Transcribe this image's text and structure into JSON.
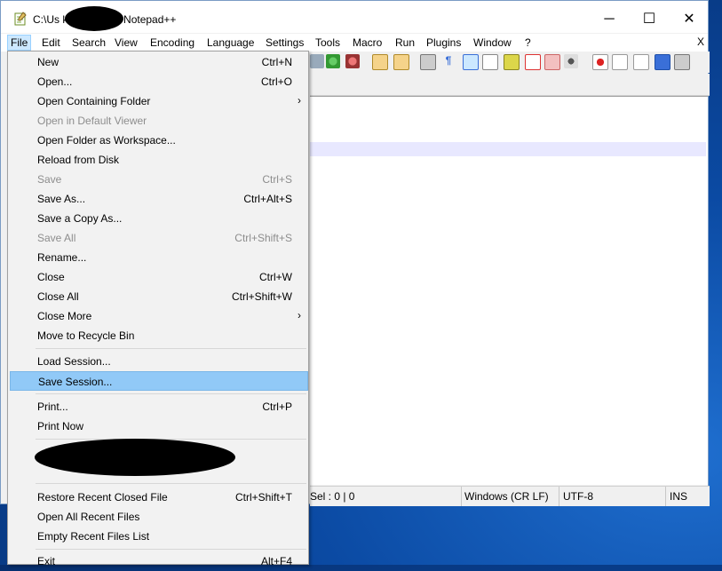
{
  "window": {
    "title": "C:\\Us          ktop\\new 1 - Notepad++",
    "controls": {
      "minimize": "─",
      "maximize": "☐",
      "close": "✕"
    }
  },
  "menubar": {
    "items": [
      "File",
      "Edit",
      "Search",
      "View",
      "Encoding",
      "Language",
      "Settings",
      "Tools",
      "Macro",
      "Run",
      "Plugins",
      "Window",
      "?"
    ],
    "close_doc": "X"
  },
  "file_menu": {
    "items": [
      {
        "label": "New",
        "shortcut": "Ctrl+N",
        "disabled": false
      },
      {
        "label": "Open...",
        "shortcut": "Ctrl+O",
        "disabled": false
      },
      {
        "label": "Open Containing Folder",
        "shortcut": "",
        "submenu": true,
        "disabled": false
      },
      {
        "label": "Open in Default Viewer",
        "shortcut": "",
        "disabled": true
      },
      {
        "label": "Open Folder as Workspace...",
        "shortcut": "",
        "disabled": false
      },
      {
        "label": "Reload from Disk",
        "shortcut": "",
        "disabled": false
      },
      {
        "label": "Save",
        "shortcut": "Ctrl+S",
        "disabled": true
      },
      {
        "label": "Save As...",
        "shortcut": "Ctrl+Alt+S",
        "disabled": false
      },
      {
        "label": "Save a Copy As...",
        "shortcut": "",
        "disabled": false
      },
      {
        "label": "Save All",
        "shortcut": "Ctrl+Shift+S",
        "disabled": true
      },
      {
        "label": "Rename...",
        "shortcut": "",
        "disabled": false
      },
      {
        "label": "Close",
        "shortcut": "Ctrl+W",
        "disabled": false
      },
      {
        "label": "Close All",
        "shortcut": "Ctrl+Shift+W",
        "disabled": false
      },
      {
        "label": "Close More",
        "shortcut": "",
        "submenu": true,
        "disabled": false
      },
      {
        "label": "Move to Recycle Bin",
        "shortcut": "",
        "disabled": false
      },
      {
        "label": "Load Session...",
        "shortcut": "",
        "disabled": false
      },
      {
        "label": "Save Session...",
        "shortcut": "",
        "disabled": false,
        "highlighted": true
      },
      {
        "label": "Print...",
        "shortcut": "Ctrl+P",
        "disabled": false
      },
      {
        "label": "Print Now",
        "shortcut": "",
        "disabled": false
      },
      {
        "label": "Restore Recent Closed File",
        "shortcut": "Ctrl+Shift+T",
        "disabled": false
      },
      {
        "label": "Open All Recent Files",
        "shortcut": "",
        "disabled": false
      },
      {
        "label": "Empty Recent Files List",
        "shortcut": "",
        "disabled": false
      },
      {
        "label": "Exit",
        "shortcut": "Alt+F4",
        "disabled": false
      }
    ],
    "submenu_arrow": "›"
  },
  "statusbar": {
    "selection": "Sel : 0 | 0",
    "eol": "Windows (CR LF)",
    "encoding": "UTF-8",
    "mode": "INS"
  },
  "colors": {
    "highlight": "#91c9f7",
    "menu_active": "#cce8ff",
    "current_line": "#e8e8ff"
  }
}
